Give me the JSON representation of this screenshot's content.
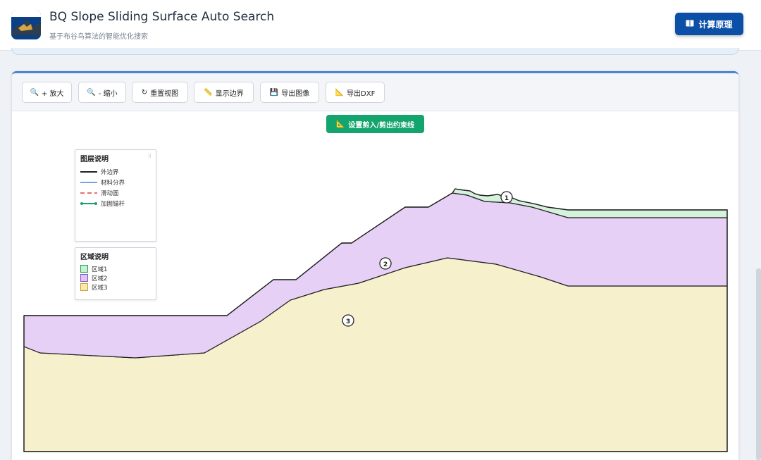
{
  "header": {
    "title": "BQ Slope Sliding Surface Auto Search",
    "subtitle": "基于布谷鸟算法的智能优化搜索",
    "calc_button": "计算原理",
    "calc_icon": "book-icon"
  },
  "toolbar": {
    "buttons": [
      {
        "icon": "🔍",
        "label": "+ 放大"
      },
      {
        "icon": "🔍",
        "label": "- 缩小"
      },
      {
        "icon": "↻",
        "label": "重置视图"
      },
      {
        "icon": "📏",
        "label": "显示边界"
      },
      {
        "icon": "💾",
        "label": "导出图像"
      },
      {
        "icon": "📐",
        "label": "导出DXF"
      }
    ]
  },
  "cut_button": {
    "icon": "📐",
    "label": "设置剪入/剪出约束线"
  },
  "layer_legend": {
    "title": "图层说明",
    "items": [
      {
        "label": "外边界",
        "style": "solid",
        "color": "#222222"
      },
      {
        "label": "材料分界",
        "style": "solid",
        "color": "#4a86d0"
      },
      {
        "label": "滑动面",
        "style": "dashed",
        "color": "#e0413a"
      },
      {
        "label": "加固锚杆",
        "style": "dotted-ends",
        "color": "#14a46e"
      }
    ]
  },
  "region_legend": {
    "title": "区域说明",
    "items": [
      {
        "label": "区域1",
        "fill": "#c7f2d2",
        "stroke": "#1f9f4e"
      },
      {
        "label": "区域2",
        "fill": "#dcc6f4",
        "stroke": "#8b4fcf"
      },
      {
        "label": "区域3",
        "fill": "#f6e9b4",
        "stroke": "#c8a230"
      }
    ]
  },
  "regions": [
    {
      "label": "1",
      "fill": "#d5f3dc"
    },
    {
      "label": "2",
      "fill": "#e6d0f6"
    },
    {
      "label": "3",
      "fill": "#f7f0cc"
    }
  ]
}
